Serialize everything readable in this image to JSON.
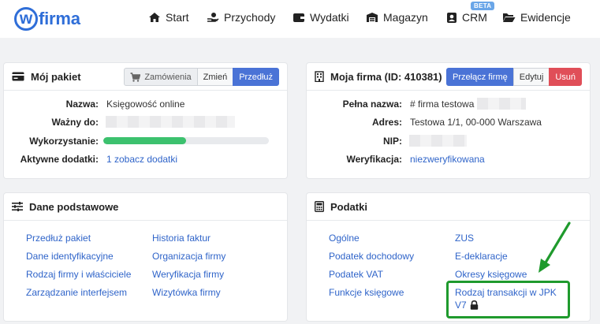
{
  "brand": {
    "logo_text": "firma",
    "logo_letter": "w"
  },
  "nav": [
    {
      "label": "Start"
    },
    {
      "label": "Przychody"
    },
    {
      "label": "Wydatki"
    },
    {
      "label": "Magazyn"
    },
    {
      "label": "CRM"
    },
    {
      "label": "Ewidencje"
    }
  ],
  "nav_badge": "BETA",
  "package": {
    "title": "Mój pakiet",
    "buttons": {
      "orders": "Zamówienia",
      "change": "Zmień",
      "extend": "Przedłuż"
    },
    "rows": {
      "name_label": "Nazwa:",
      "name_value": "Księgowość online",
      "valid_label": "Ważny do:",
      "usage_label": "Wykorzystanie:",
      "usage_fraction": 0.5,
      "addons_label": "Aktywne dodatki:",
      "addons_value": "1 zobacz dodatki"
    }
  },
  "company": {
    "title": "Moja firma (ID: 410381)",
    "buttons": {
      "switch": "Przełącz firmę",
      "edit": "Edytuj",
      "delete": "Usuń"
    },
    "rows": {
      "fullname_label": "Pełna nazwa:",
      "fullname_value": "# firma testowa",
      "address_label": "Adres:",
      "address_value": "Testowa 1/1, 00-000 Warszawa",
      "nip_label": "NIP:",
      "verify_label": "Weryfikacja:",
      "verify_value": "niezweryfikowana"
    }
  },
  "basic": {
    "title": "Dane podstawowe",
    "links_left": [
      "Przedłuż pakiet",
      "Dane identyfikacyjne",
      "Rodzaj firmy i właściciele",
      "Zarządzanie interfejsem"
    ],
    "links_right": [
      "Historia faktur",
      "Organizacja firmy",
      "Weryfikacja firmy",
      "Wizytówka firmy"
    ]
  },
  "taxes": {
    "title": "Podatki",
    "links_left": [
      "Ogólne",
      "Podatek dochodowy",
      "Podatek VAT",
      "Funkcje księgowe"
    ],
    "links_right": [
      "ZUS",
      "E-deklaracje",
      "Okresy księgowe"
    ],
    "jpk_line1": "Rodzaj transakcji w JPK",
    "jpk_line2": "V7"
  },
  "colors": {
    "accent": "#4a73d6",
    "danger": "#e04e58",
    "progress": "#3cc16e",
    "annotation": "#1f9a2d"
  }
}
